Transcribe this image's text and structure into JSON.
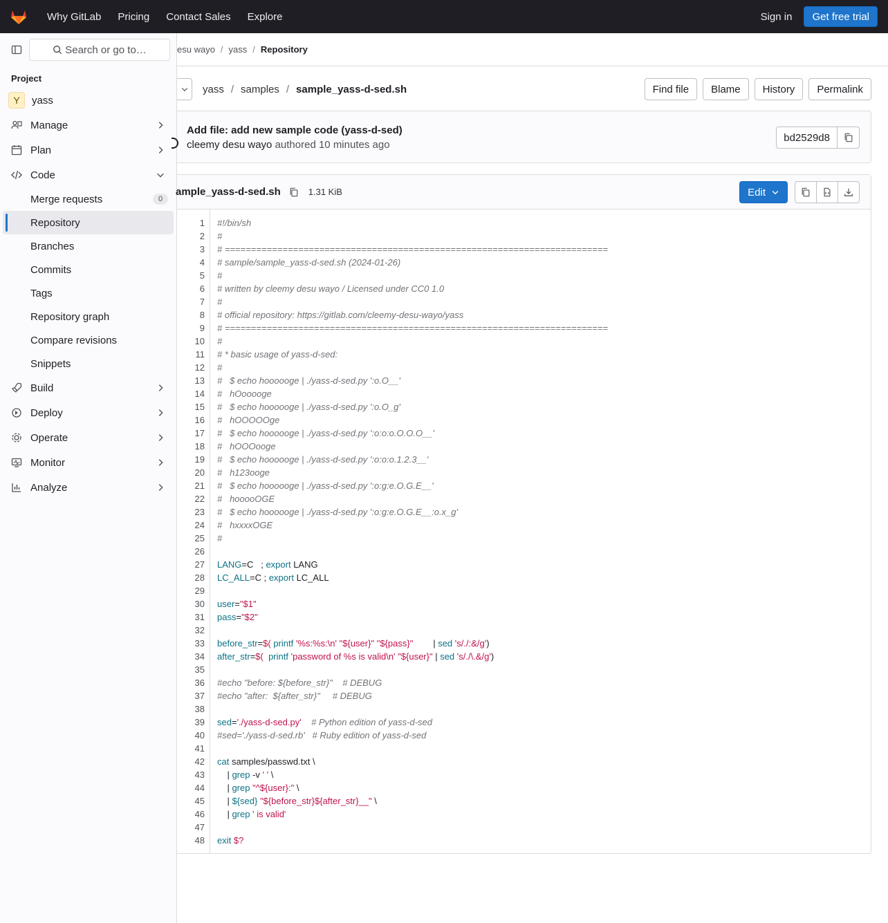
{
  "topnav": {
    "items": [
      "Why GitLab",
      "Pricing",
      "Contact Sales",
      "Explore"
    ],
    "sign_in": "Sign in",
    "trial": "Get free trial"
  },
  "sidebar": {
    "search_placeholder": "Search or go to…",
    "section": "Project",
    "project_letter": "Y",
    "project_name": "yass",
    "items": [
      "Manage",
      "Plan",
      "Code"
    ],
    "code_sub": [
      "Merge requests",
      "Repository",
      "Branches",
      "Commits",
      "Tags",
      "Repository graph",
      "Compare revisions",
      "Snippets"
    ],
    "merge_requests_count": "0",
    "items_after": [
      "Build",
      "Deploy",
      "Operate",
      "Monitor",
      "Analyze"
    ]
  },
  "breadcrumb": [
    "esu wayo",
    "yass",
    "Repository"
  ],
  "path": {
    "parts": [
      "yass",
      "samples",
      "sample_yass-d-sed.sh"
    ]
  },
  "actions": [
    "Find file",
    "Blame",
    "History",
    "Permalink"
  ],
  "commit": {
    "title": "Add file: add new sample code (yass-d-sed)",
    "author": "cleemy desu wayo",
    "meta": "authored 10 minutes ago",
    "sha": "bd2529d8"
  },
  "viewer": {
    "filename": "ample_yass-d-sed.sh",
    "size": "1.31 KiB",
    "edit": "Edit"
  },
  "code": [
    "#!/bin/sh",
    "#",
    "# =========================================================================",
    "# sample/sample_yass-d-sed.sh (2024-01-26)",
    "#",
    "# written by cleemy desu wayo / Licensed under CC0 1.0",
    "#",
    "# official repository: https://gitlab.com/cleemy-desu-wayo/yass",
    "# =========================================================================",
    "#",
    "# * basic usage of yass-d-sed:",
    "#",
    "#   $ echo hoooooge | ./yass-d-sed.py ':o.O__'",
    "#   hOooooge",
    "#   $ echo hoooooge | ./yass-d-sed.py ':o.O_g'",
    "#   hOOOOOge",
    "#   $ echo hoooooge | ./yass-d-sed.py ':o:o:o.O.O.O__'",
    "#   hOOOooge",
    "#   $ echo hoooooge | ./yass-d-sed.py ':o:o:o.1.2.3__'",
    "#   h123ooge",
    "#   $ echo hoooooge | ./yass-d-sed.py ':o:g:e.O.G.E__'",
    "#   hooooOGE",
    "#   $ echo hoooooge | ./yass-d-sed.py ':o:g:e.O.G.E__:o.x_g'",
    "#   hxxxxOGE",
    "#",
    "",
    "LANG=C   ; export LANG",
    "LC_ALL=C ; export LC_ALL",
    "",
    "user=\"$1\"",
    "pass=\"$2\"",
    "",
    "before_str=$( printf '%s:%s:\\n' \"${user}\" \"${pass}\"        | sed 's/./:&/g')",
    "after_str=$(  printf 'password of %s is valid\\n' \"${user}\" | sed 's/./\\.&/g')",
    "",
    "#echo \"before: ${before_str}\"    # DEBUG",
    "#echo \"after:  ${after_str}\"     # DEBUG",
    "",
    "sed='./yass-d-sed.py'    # Python edition of yass-d-sed",
    "#sed='./yass-d-sed.rb'   # Ruby edition of yass-d-sed",
    "",
    "cat samples/passwd.txt \\",
    "    | grep -v ' ' \\",
    "    | grep \"^${user}:\" \\",
    "    | ${sed} \"${before_str}${after_str}__\" \\",
    "    | grep ' is valid'",
    "",
    "exit $?"
  ]
}
